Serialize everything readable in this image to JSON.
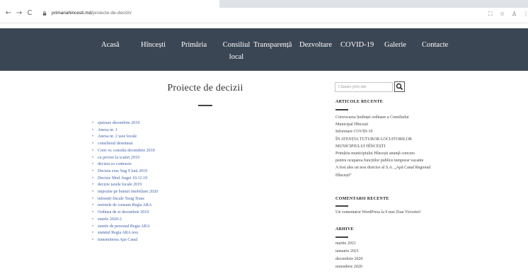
{
  "browser": {
    "url_domain": "primariahincesti.md",
    "url_path": "/proiecte-de-decizii/"
  },
  "menu": [
    {
      "label": "Acasă"
    },
    {
      "label": "Hîncești"
    },
    {
      "label": "Primăria"
    },
    {
      "label": "Consiliul",
      "label2": "local"
    },
    {
      "label": "Transparență"
    },
    {
      "label": "Dezvoltare"
    },
    {
      "label": "COVID-19"
    },
    {
      "label": "Galerie"
    },
    {
      "label": "Contacte"
    }
  ],
  "main": {
    "title": "Proiecte de decizii",
    "documents": [
      "ajutoare decembrie 2019",
      "Anexa nr. 1",
      "Anexa nr. 2 taxe locale",
      "consilierul desemnat",
      "Conv oc consiliu decembrie 2019",
      "cu privire la scutiri 2019",
      "decizia cu contracte",
      "Decizia exec bug 9 luni 2019",
      "Decizie Mod. buget 10.12.19",
      "decizie taxele locale 2019",
      "impozite pe bunuri imobiliare 2020",
      "inlesniri fiscale Tesig Trans",
      "normele de consum Regia ARA",
      "Ordinea de zi decembrie 2019",
      "statele 2020-2",
      "statele de personal Regia ARA",
      "statutul Regia ARA nou",
      "transmiterea Apa Canal"
    ]
  },
  "sidebar": {
    "search_placeholder": "Căutare prin site",
    "recent_articles_title": "ARTICOLE RECENTE",
    "recent_articles_lines": [
      "Convocarea Ședinței ordinare a Consiliului",
      "Municipal Hîncești",
      "Informare COVID-19",
      "ÎN ATENȚIA TUTUROR LOCUITORILOR",
      "MUNICIPIULUI HÎNCEȘTI",
      "Primăria municipiului Hîncești anunță concurs",
      "pentru ocuparea funcțiilor publice temporar vacante",
      "A fost ales un nou director al S.A. „Apă Canal Regional",
      "Hîncești”"
    ],
    "recent_comments_title": "COMENTARII RECENTE",
    "recent_comment": "Un comentator WordPress la 9 mai Ziua Victoriei!",
    "archives_title": "ARHIVE",
    "archives": [
      "martie 2021",
      "ianuarie 2021",
      "decembrie 2020",
      "noiembrie 2020"
    ]
  }
}
